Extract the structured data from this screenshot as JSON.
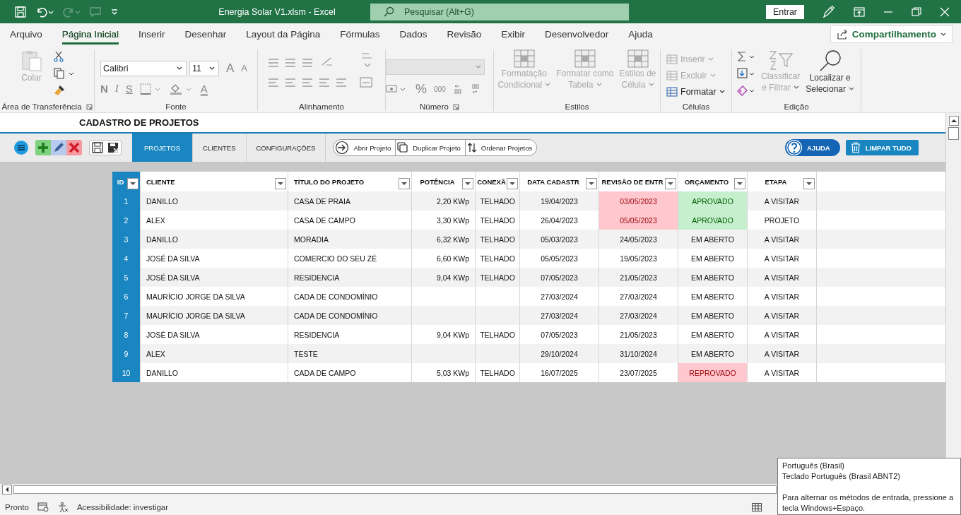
{
  "title_bar": {
    "title": "Energia Solar V1.xlsm  -  Excel",
    "search_placeholder": "Pesquisar (Alt+G)",
    "sign_in": "Entrar"
  },
  "menu_tabs": [
    {
      "label": "Arquivo",
      "selected": false
    },
    {
      "label": "Página Inicial",
      "selected": true
    },
    {
      "label": "Inserir",
      "selected": false
    },
    {
      "label": "Desenhar",
      "selected": false
    },
    {
      "label": "Layout da Página",
      "selected": false
    },
    {
      "label": "Fórmulas",
      "selected": false
    },
    {
      "label": "Dados",
      "selected": false
    },
    {
      "label": "Revisão",
      "selected": false
    },
    {
      "label": "Exibir",
      "selected": false
    },
    {
      "label": "Desenvolvedor",
      "selected": false
    },
    {
      "label": "Ajuda",
      "selected": false
    }
  ],
  "share_button": "Compartilhamento",
  "ribbon": {
    "clipboard": {
      "paste": "Colar",
      "paste_disabled": true,
      "group": "Área de Transferência"
    },
    "font": {
      "name": "Calibri",
      "size": "11",
      "grow": "A",
      "shrink": "A",
      "bold": "N",
      "italic": "I",
      "underline": "S",
      "color_letter": "A",
      "group": "Fonte"
    },
    "alignment": {
      "group": "Alinhamento"
    },
    "number": {
      "percent": "%",
      "thousands": "000",
      "group": "Número"
    },
    "styles": {
      "buttons": [
        {
          "lines": [
            "Formatação",
            "Condicional"
          ],
          "disabled": true
        },
        {
          "lines": [
            "Formatar como",
            "Tabela"
          ],
          "disabled": true
        },
        {
          "lines": [
            "Estilos de",
            "Célula"
          ],
          "disabled": true
        }
      ],
      "group": "Estilos"
    },
    "cells": {
      "buttons": [
        {
          "label": "Inserir",
          "disabled": true
        },
        {
          "label": "Excluir",
          "disabled": true
        },
        {
          "label": "Formatar",
          "disabled": false
        }
      ],
      "group": "Células"
    },
    "editing": {
      "buttons": [
        {
          "lines": [
            "Classificar",
            "e Filtrar"
          ],
          "disabled": true
        },
        {
          "lines": [
            "Localizar e",
            "Selecionar"
          ],
          "disabled": false
        }
      ],
      "group": "Edição"
    }
  },
  "sheet": {
    "title": "CADASTRO DE PROJETOS",
    "tabs": [
      {
        "label": "PROJETOS",
        "selected": true
      },
      {
        "label": "CLIENTES",
        "selected": false
      },
      {
        "label": "CONFIGURAÇÕES",
        "selected": false
      }
    ],
    "actions": [
      "Abrir Projeto",
      "Duplicar Projeto",
      "Ordenar Projetos"
    ],
    "help": "AJUDA",
    "clear": "LIMPAR TUDO",
    "table": {
      "columns": [
        "ID",
        "CLIENTE",
        "TÍTULO DO PROJETO",
        "POTÊNCIA",
        "CONEXÃ",
        "DATA CADASTR",
        "REVISÃO DE ENTR",
        "ORÇAMENTO",
        "ETAPA"
      ],
      "rows": [
        {
          "id": "1",
          "client": "DANILLO",
          "title": "CASA DE PRAIA",
          "power": "2,20 KWp",
          "connection": "TELHADO",
          "registered": "19/04/2023",
          "review": {
            "text": "03/05/2023",
            "kind": "bad"
          },
          "budget": {
            "text": "APROVADO",
            "kind": "good"
          },
          "stage": "A VISITAR"
        },
        {
          "id": "2",
          "client": "ALEX",
          "title": "CASA DE CAMPO",
          "power": "3,30 KWp",
          "connection": "TELHADO",
          "registered": "26/04/2023",
          "review": {
            "text": "05/05/2023",
            "kind": "bad"
          },
          "budget": {
            "text": "APROVADO",
            "kind": "good"
          },
          "stage": "PROJETO"
        },
        {
          "id": "3",
          "client": "DANILLO",
          "title": "MORADIA",
          "power": "6,32 KWp",
          "connection": "TELHADO",
          "registered": "05/03/2023",
          "review": {
            "text": "24/05/2023",
            "kind": "plain"
          },
          "budget": {
            "text": "EM ABERTO",
            "kind": "plain"
          },
          "stage": "A VISITAR"
        },
        {
          "id": "4",
          "client": "JOSÉ DA SILVA",
          "title": "COMERCIO DO SEU ZÉ",
          "power": "6,60 KWp",
          "connection": "TELHADO",
          "registered": "05/05/2023",
          "review": {
            "text": "19/05/2023",
            "kind": "plain"
          },
          "budget": {
            "text": "EM ABERTO",
            "kind": "plain"
          },
          "stage": "A VISITAR"
        },
        {
          "id": "5",
          "client": "JOSÉ DA SILVA",
          "title": "RESIDENCIA",
          "power": "9,04 KWp",
          "connection": "TELHADO",
          "registered": "07/05/2023",
          "review": {
            "text": "21/05/2023",
            "kind": "plain"
          },
          "budget": {
            "text": "EM ABERTO",
            "kind": "plain"
          },
          "stage": "A VISITAR"
        },
        {
          "id": "6",
          "client": "MAURÍCIO JORGE DA SILVA",
          "title": "CADA DE CONDOMÍNIO",
          "registered": "27/03/2024",
          "review": {
            "text": "27/03/2024",
            "kind": "plain"
          },
          "budget": {
            "text": "EM ABERTO",
            "kind": "plain"
          },
          "stage": "A VISITAR"
        },
        {
          "id": "7",
          "client": "MAURÍCIO JORGE DA SILVA",
          "title": "CADA DE CONDOMÍNIO",
          "registered": "27/03/2024",
          "review": {
            "text": "27/03/2024",
            "kind": "plain"
          },
          "budget": {
            "text": "EM ABERTO",
            "kind": "plain"
          },
          "stage": "A VISITAR"
        },
        {
          "id": "8",
          "client": "JOSÉ DA SILVA",
          "title": "RESIDENCIA",
          "power": "9,04 KWp",
          "connection": "TELHADO",
          "registered": "07/05/2023",
          "review": {
            "text": "21/05/2023",
            "kind": "plain"
          },
          "budget": {
            "text": "EM ABERTO",
            "kind": "plain"
          },
          "stage": "A VISITAR"
        },
        {
          "id": "9",
          "client": "ALEX",
          "title": "TESTE",
          "registered": "29/10/2024",
          "review": {
            "text": "31/10/2024",
            "kind": "plain"
          },
          "budget": {
            "text": "EM ABERTO",
            "kind": "plain"
          },
          "stage": "A VISITAR"
        },
        {
          "id": "10",
          "client": "DANILLO",
          "title": "CADA DE CAMPO",
          "power": "5,03 KWp",
          "connection": "TELHADO",
          "registered": "16/07/2025",
          "review": {
            "text": "23/07/2025",
            "kind": "plain"
          },
          "budget": {
            "text": "REPROVADO",
            "kind": "bad"
          },
          "stage": "A VISITAR"
        }
      ]
    }
  },
  "status_bar": {
    "ready": "Pronto",
    "accessibility": "Acessibilidade: investigar"
  },
  "tooltip": {
    "language": "Português (Brasil)",
    "keyboard": "Teclado Português (Brasil ABNT2)",
    "hint": "Para alternar os métodos de entrada, pressione a tecla Windows+Espaço."
  }
}
